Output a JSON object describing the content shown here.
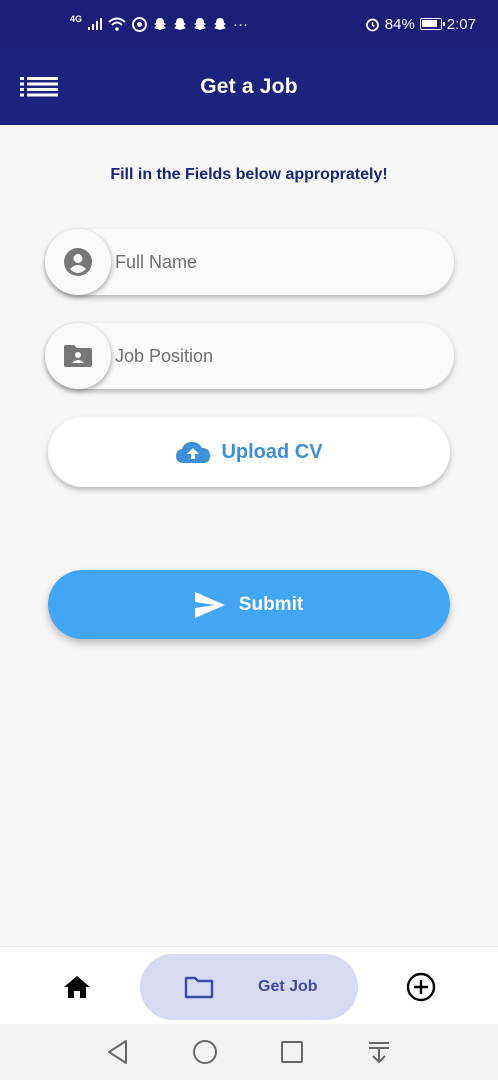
{
  "status_bar": {
    "network": "4G",
    "more": "···",
    "battery": "84%",
    "time": "2:07"
  },
  "app_bar": {
    "title": "Get a Job",
    "menu_icon": "menu-list-icon"
  },
  "form": {
    "instruction": "Fill in the Fields below approprately!",
    "full_name": {
      "placeholder": "Full Name",
      "value": "",
      "icon": "account-circle-icon"
    },
    "job_position": {
      "placeholder": "Job Position",
      "value": "",
      "icon": "folder-person-icon"
    },
    "upload_label": "Upload CV",
    "upload_icon": "cloud-upload-icon",
    "submit_label": "Submit",
    "submit_icon": "send-icon"
  },
  "bottom_nav": {
    "home_icon": "home-icon",
    "active_label": "Get Job",
    "active_icon": "folder-icon",
    "add_icon": "add-circle-icon"
  },
  "colors": {
    "primary": "#1a237e",
    "accent": "#42a5f5",
    "upload_text": "#3d8fd9",
    "nav_active_bg": "#d7daf2",
    "background": "#f7f7f7"
  }
}
